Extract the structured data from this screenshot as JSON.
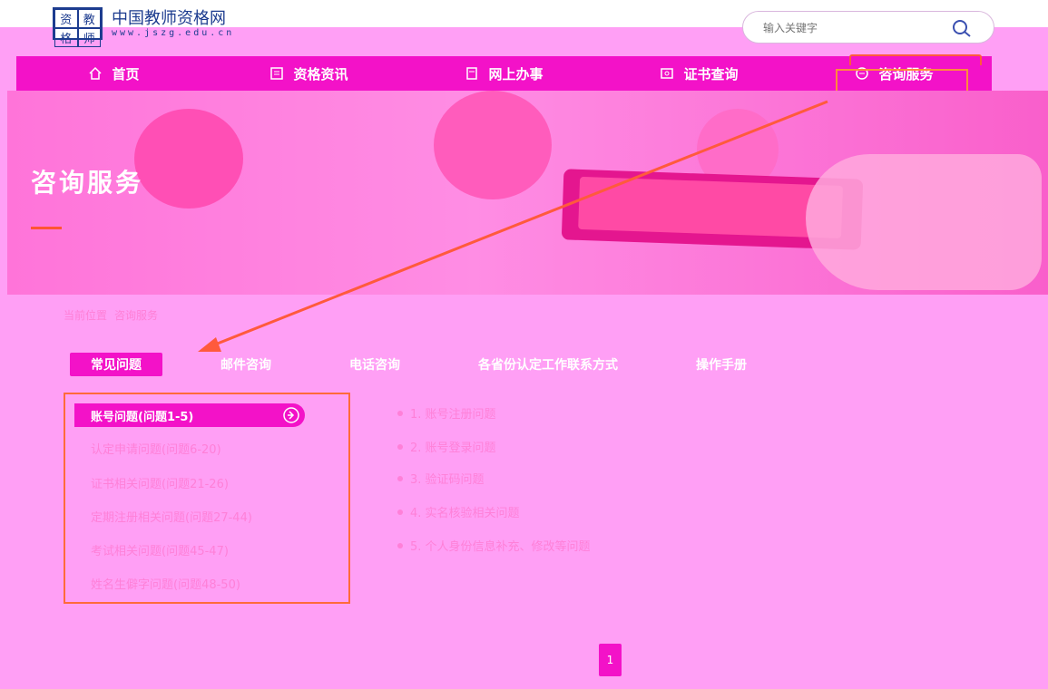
{
  "header": {
    "logo_chars": [
      "资",
      "教",
      "格",
      "师"
    ],
    "site_title": "中国教师资格网",
    "site_url": "www.jszg.edu.cn",
    "search_placeholder": "输入关键字"
  },
  "nav": {
    "items": [
      {
        "label": "首页",
        "icon": "home-icon"
      },
      {
        "label": "资格资讯",
        "icon": "news-icon"
      },
      {
        "label": "网上办事",
        "icon": "document-icon"
      },
      {
        "label": "证书查询",
        "icon": "certificate-icon"
      },
      {
        "label": "咨询服务",
        "icon": "chat-icon"
      }
    ],
    "active_index": 4
  },
  "banner": {
    "title": "咨询服务"
  },
  "breadcrumb": {
    "prefix": "当前位置",
    "current": "咨询服务"
  },
  "tabs": [
    {
      "label": "常见问题"
    },
    {
      "label": "邮件咨询"
    },
    {
      "label": "电话咨询"
    },
    {
      "label": "各省份认定工作联系方式"
    },
    {
      "label": "操作手册"
    }
  ],
  "categories": [
    {
      "label": "账号问题(问题1-5)"
    },
    {
      "label": "认定申请问题(问题6-20)"
    },
    {
      "label": "证书相关问题(问题21-26)"
    },
    {
      "label": "定期注册相关问题(问题27-44)"
    },
    {
      "label": "考试相关问题(问题45-47)"
    },
    {
      "label": "姓名生僻字问题(问题48-50)"
    }
  ],
  "questions": [
    {
      "label": "1. 账号注册问题"
    },
    {
      "label": "2. 账号登录问题"
    },
    {
      "label": "3. 验证码问题"
    },
    {
      "label": "4. 实名核验相关问题"
    },
    {
      "label": "5. 个人身份信息补充、修改等问题"
    }
  ],
  "pagination": {
    "current_page": "1"
  },
  "colors": {
    "background": "#ff9ff5",
    "accent": "#f312c8",
    "highlight_border": "#ff6a3a",
    "logo_blue": "#1d3c8f"
  }
}
